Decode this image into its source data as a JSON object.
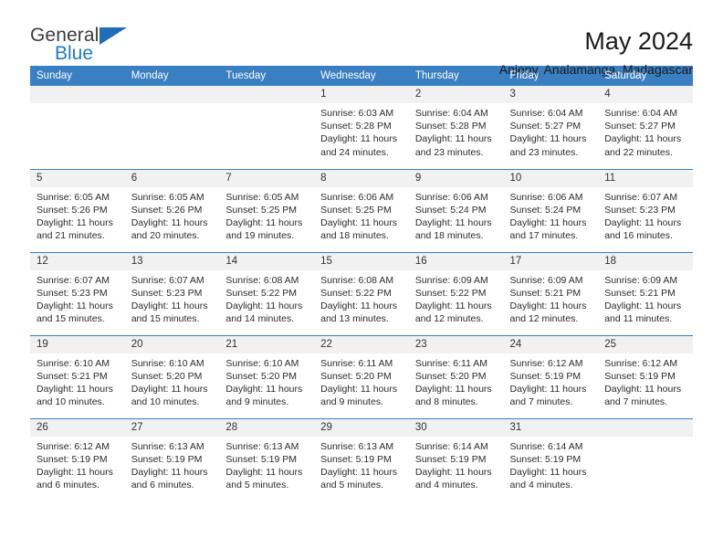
{
  "brand": {
    "line1": "General",
    "line2": "Blue",
    "triangle_icon": "brand-triangle-icon",
    "color_dark": "#3c3c3c",
    "color_blue": "#1f7ac4"
  },
  "header": {
    "title": "May 2024",
    "subtitle": "Anjepy, Analamanga, Madagascar"
  },
  "theme": {
    "header_bg": "#3a7fc1",
    "header_text": "#ffffff",
    "daynum_bg": "#f1f1f1",
    "row_divider": "#3a7fc1",
    "body_text": "#2b2b2b"
  },
  "calendar": {
    "weekday_headers": [
      "Sunday",
      "Monday",
      "Tuesday",
      "Wednesday",
      "Thursday",
      "Friday",
      "Saturday"
    ],
    "labels": {
      "sunrise_prefix": "Sunrise:",
      "sunset_prefix": "Sunset:",
      "daylight_prefix": "Daylight:"
    },
    "weeks": [
      [
        {
          "day": "",
          "empty": true
        },
        {
          "day": "",
          "empty": true
        },
        {
          "day": "",
          "empty": true
        },
        {
          "day": "1",
          "sunrise": "Sunrise: 6:03 AM",
          "sunset": "Sunset: 5:28 PM",
          "daylight": "Daylight: 11 hours and 24 minutes."
        },
        {
          "day": "2",
          "sunrise": "Sunrise: 6:04 AM",
          "sunset": "Sunset: 5:28 PM",
          "daylight": "Daylight: 11 hours and 23 minutes."
        },
        {
          "day": "3",
          "sunrise": "Sunrise: 6:04 AM",
          "sunset": "Sunset: 5:27 PM",
          "daylight": "Daylight: 11 hours and 23 minutes."
        },
        {
          "day": "4",
          "sunrise": "Sunrise: 6:04 AM",
          "sunset": "Sunset: 5:27 PM",
          "daylight": "Daylight: 11 hours and 22 minutes."
        }
      ],
      [
        {
          "day": "5",
          "sunrise": "Sunrise: 6:05 AM",
          "sunset": "Sunset: 5:26 PM",
          "daylight": "Daylight: 11 hours and 21 minutes."
        },
        {
          "day": "6",
          "sunrise": "Sunrise: 6:05 AM",
          "sunset": "Sunset: 5:26 PM",
          "daylight": "Daylight: 11 hours and 20 minutes."
        },
        {
          "day": "7",
          "sunrise": "Sunrise: 6:05 AM",
          "sunset": "Sunset: 5:25 PM",
          "daylight": "Daylight: 11 hours and 19 minutes."
        },
        {
          "day": "8",
          "sunrise": "Sunrise: 6:06 AM",
          "sunset": "Sunset: 5:25 PM",
          "daylight": "Daylight: 11 hours and 18 minutes."
        },
        {
          "day": "9",
          "sunrise": "Sunrise: 6:06 AM",
          "sunset": "Sunset: 5:24 PM",
          "daylight": "Daylight: 11 hours and 18 minutes."
        },
        {
          "day": "10",
          "sunrise": "Sunrise: 6:06 AM",
          "sunset": "Sunset: 5:24 PM",
          "daylight": "Daylight: 11 hours and 17 minutes."
        },
        {
          "day": "11",
          "sunrise": "Sunrise: 6:07 AM",
          "sunset": "Sunset: 5:23 PM",
          "daylight": "Daylight: 11 hours and 16 minutes."
        }
      ],
      [
        {
          "day": "12",
          "sunrise": "Sunrise: 6:07 AM",
          "sunset": "Sunset: 5:23 PM",
          "daylight": "Daylight: 11 hours and 15 minutes."
        },
        {
          "day": "13",
          "sunrise": "Sunrise: 6:07 AM",
          "sunset": "Sunset: 5:23 PM",
          "daylight": "Daylight: 11 hours and 15 minutes."
        },
        {
          "day": "14",
          "sunrise": "Sunrise: 6:08 AM",
          "sunset": "Sunset: 5:22 PM",
          "daylight": "Daylight: 11 hours and 14 minutes."
        },
        {
          "day": "15",
          "sunrise": "Sunrise: 6:08 AM",
          "sunset": "Sunset: 5:22 PM",
          "daylight": "Daylight: 11 hours and 13 minutes."
        },
        {
          "day": "16",
          "sunrise": "Sunrise: 6:09 AM",
          "sunset": "Sunset: 5:22 PM",
          "daylight": "Daylight: 11 hours and 12 minutes."
        },
        {
          "day": "17",
          "sunrise": "Sunrise: 6:09 AM",
          "sunset": "Sunset: 5:21 PM",
          "daylight": "Daylight: 11 hours and 12 minutes."
        },
        {
          "day": "18",
          "sunrise": "Sunrise: 6:09 AM",
          "sunset": "Sunset: 5:21 PM",
          "daylight": "Daylight: 11 hours and 11 minutes."
        }
      ],
      [
        {
          "day": "19",
          "sunrise": "Sunrise: 6:10 AM",
          "sunset": "Sunset: 5:21 PM",
          "daylight": "Daylight: 11 hours and 10 minutes."
        },
        {
          "day": "20",
          "sunrise": "Sunrise: 6:10 AM",
          "sunset": "Sunset: 5:20 PM",
          "daylight": "Daylight: 11 hours and 10 minutes."
        },
        {
          "day": "21",
          "sunrise": "Sunrise: 6:10 AM",
          "sunset": "Sunset: 5:20 PM",
          "daylight": "Daylight: 11 hours and 9 minutes."
        },
        {
          "day": "22",
          "sunrise": "Sunrise: 6:11 AM",
          "sunset": "Sunset: 5:20 PM",
          "daylight": "Daylight: 11 hours and 9 minutes."
        },
        {
          "day": "23",
          "sunrise": "Sunrise: 6:11 AM",
          "sunset": "Sunset: 5:20 PM",
          "daylight": "Daylight: 11 hours and 8 minutes."
        },
        {
          "day": "24",
          "sunrise": "Sunrise: 6:12 AM",
          "sunset": "Sunset: 5:19 PM",
          "daylight": "Daylight: 11 hours and 7 minutes."
        },
        {
          "day": "25",
          "sunrise": "Sunrise: 6:12 AM",
          "sunset": "Sunset: 5:19 PM",
          "daylight": "Daylight: 11 hours and 7 minutes."
        }
      ],
      [
        {
          "day": "26",
          "sunrise": "Sunrise: 6:12 AM",
          "sunset": "Sunset: 5:19 PM",
          "daylight": "Daylight: 11 hours and 6 minutes."
        },
        {
          "day": "27",
          "sunrise": "Sunrise: 6:13 AM",
          "sunset": "Sunset: 5:19 PM",
          "daylight": "Daylight: 11 hours and 6 minutes."
        },
        {
          "day": "28",
          "sunrise": "Sunrise: 6:13 AM",
          "sunset": "Sunset: 5:19 PM",
          "daylight": "Daylight: 11 hours and 5 minutes."
        },
        {
          "day": "29",
          "sunrise": "Sunrise: 6:13 AM",
          "sunset": "Sunset: 5:19 PM",
          "daylight": "Daylight: 11 hours and 5 minutes."
        },
        {
          "day": "30",
          "sunrise": "Sunrise: 6:14 AM",
          "sunset": "Sunset: 5:19 PM",
          "daylight": "Daylight: 11 hours and 4 minutes."
        },
        {
          "day": "31",
          "sunrise": "Sunrise: 6:14 AM",
          "sunset": "Sunset: 5:19 PM",
          "daylight": "Daylight: 11 hours and 4 minutes."
        },
        {
          "day": "",
          "empty": true
        }
      ]
    ]
  }
}
